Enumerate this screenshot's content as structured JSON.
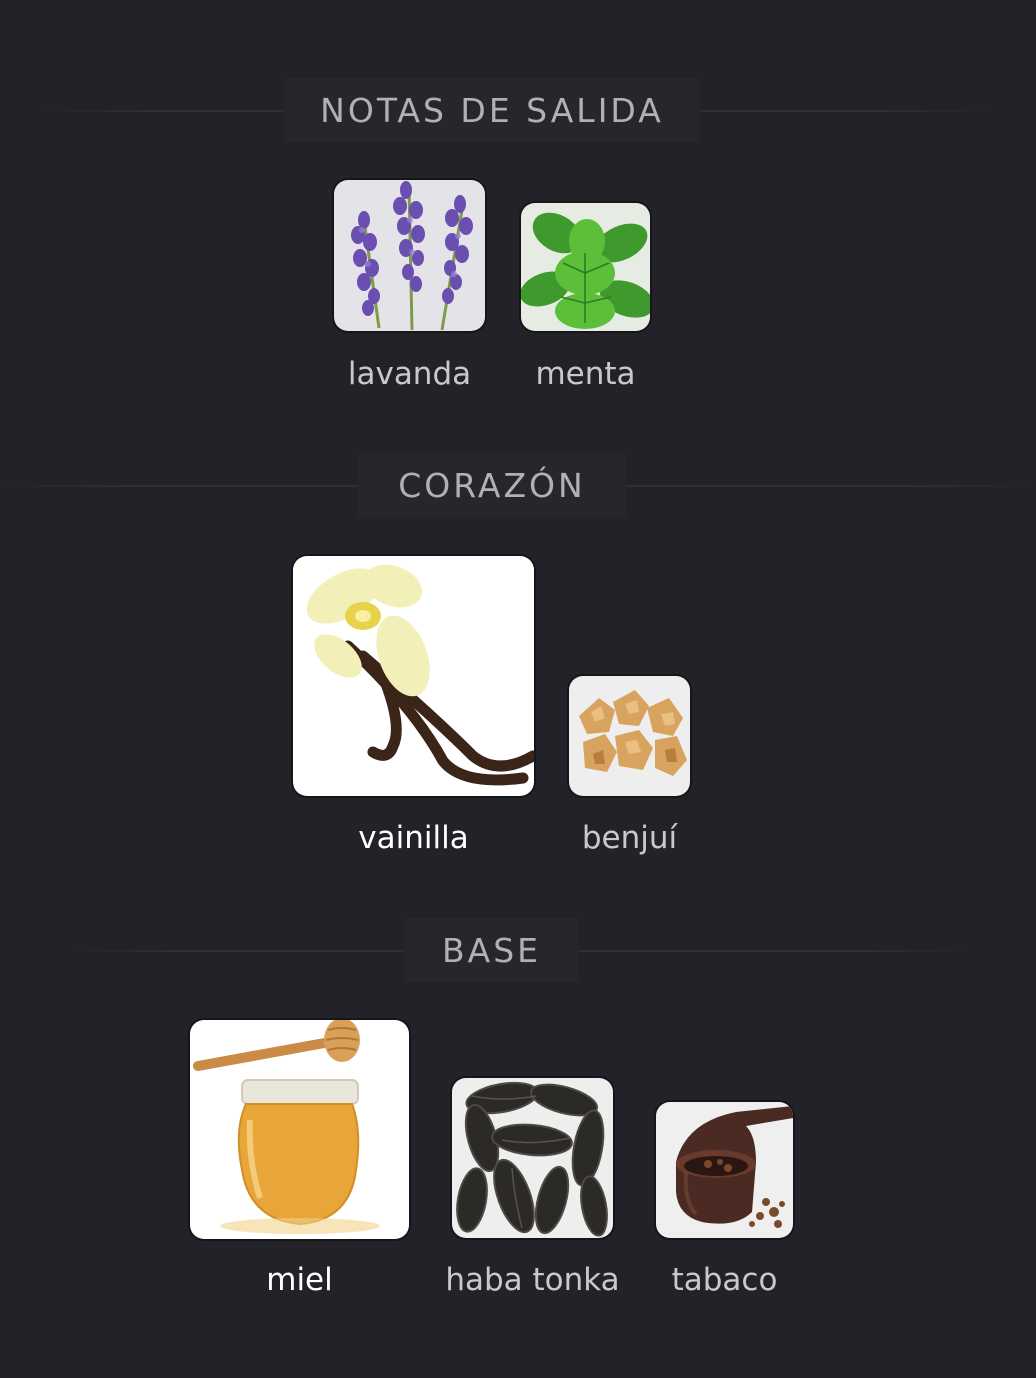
{
  "sections": {
    "top": {
      "title": "NOTAS DE SALIDA",
      "notes": [
        {
          "name": "lavanda",
          "image": "lavender-image"
        },
        {
          "name": "menta",
          "image": "mint-image"
        }
      ]
    },
    "heart": {
      "title": "CORAZÓN",
      "notes": [
        {
          "name": "vainilla",
          "image": "vanilla-image"
        },
        {
          "name": "benjuí",
          "image": "benzoin-image"
        }
      ]
    },
    "base": {
      "title": "BASE",
      "notes": [
        {
          "name": "miel",
          "image": "honey-image"
        },
        {
          "name": "haba tonka",
          "image": "tonka-bean-image"
        },
        {
          "name": "tabaco",
          "image": "tobacco-image"
        }
      ]
    }
  },
  "colors": {
    "background": "#232228",
    "header_text": "#b0b0b6",
    "label_text": "#c9c9cc"
  }
}
